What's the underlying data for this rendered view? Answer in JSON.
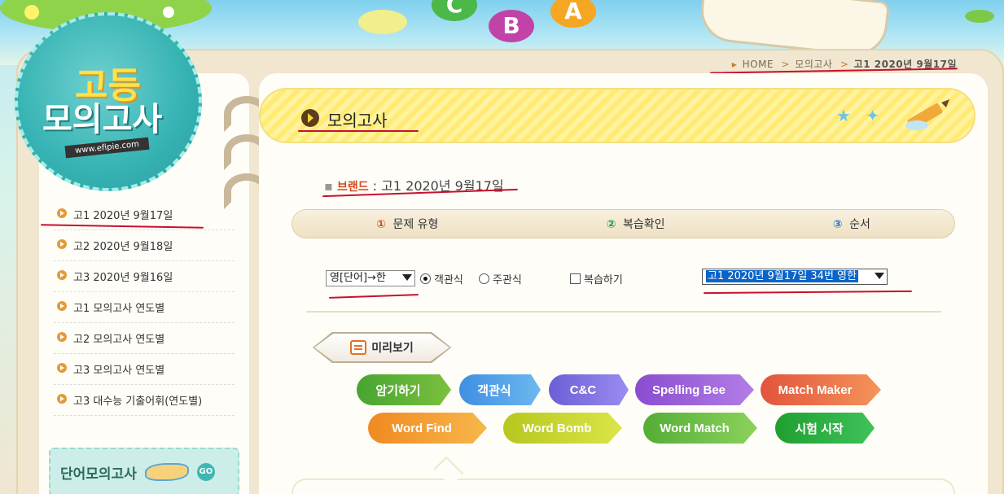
{
  "breadcrumb": {
    "home": "HOME",
    "section": "모의고사",
    "current": "고1 2020년 9월17일"
  },
  "logo": {
    "line1": "고등",
    "line2": "모의고사",
    "url": "www.efipie.com"
  },
  "sidebar": {
    "items": [
      {
        "label": "고1 2020년 9월17일"
      },
      {
        "label": "고2 2020년 9월18일"
      },
      {
        "label": "고3 2020년 9월16일"
      },
      {
        "label": "고1 모의고사 연도별"
      },
      {
        "label": "고2 모의고사 연도별"
      },
      {
        "label": "고3 모의고사 연도별"
      },
      {
        "label": "고3 대수능 기출어휘(연도별)"
      }
    ],
    "vocab_banner": {
      "label": "단어모의고사",
      "go": "GO"
    }
  },
  "main": {
    "title": "모의고사",
    "brand_label": "브랜드",
    "brand_value": "고1 2020년 9월17일",
    "steps": [
      {
        "num": "①",
        "label": "문제 유형"
      },
      {
        "num": "②",
        "label": "복습확인"
      },
      {
        "num": "③",
        "label": "순서"
      }
    ],
    "controls": {
      "type_select": "영[단어]→한",
      "radio_objective": "객관식",
      "radio_subjective": "주관식",
      "review_checkbox": "복습하기",
      "unit_select": "고1 2020년 9월17일 34번 영한"
    },
    "preview_label": "미리보기",
    "games": {
      "amgi": "암기하기",
      "gaek": "객관식",
      "cnc": "C&C",
      "spelling": "Spelling Bee",
      "match_maker": "Match Maker",
      "word_find": "Word Find",
      "word_bomb": "Word Bomb",
      "word_match": "Word Match",
      "test_start": "시험 시작"
    }
  },
  "colors": {
    "accent": "#c8102e",
    "title_bar": "#ffeb73",
    "logo": "#36b3b3"
  }
}
